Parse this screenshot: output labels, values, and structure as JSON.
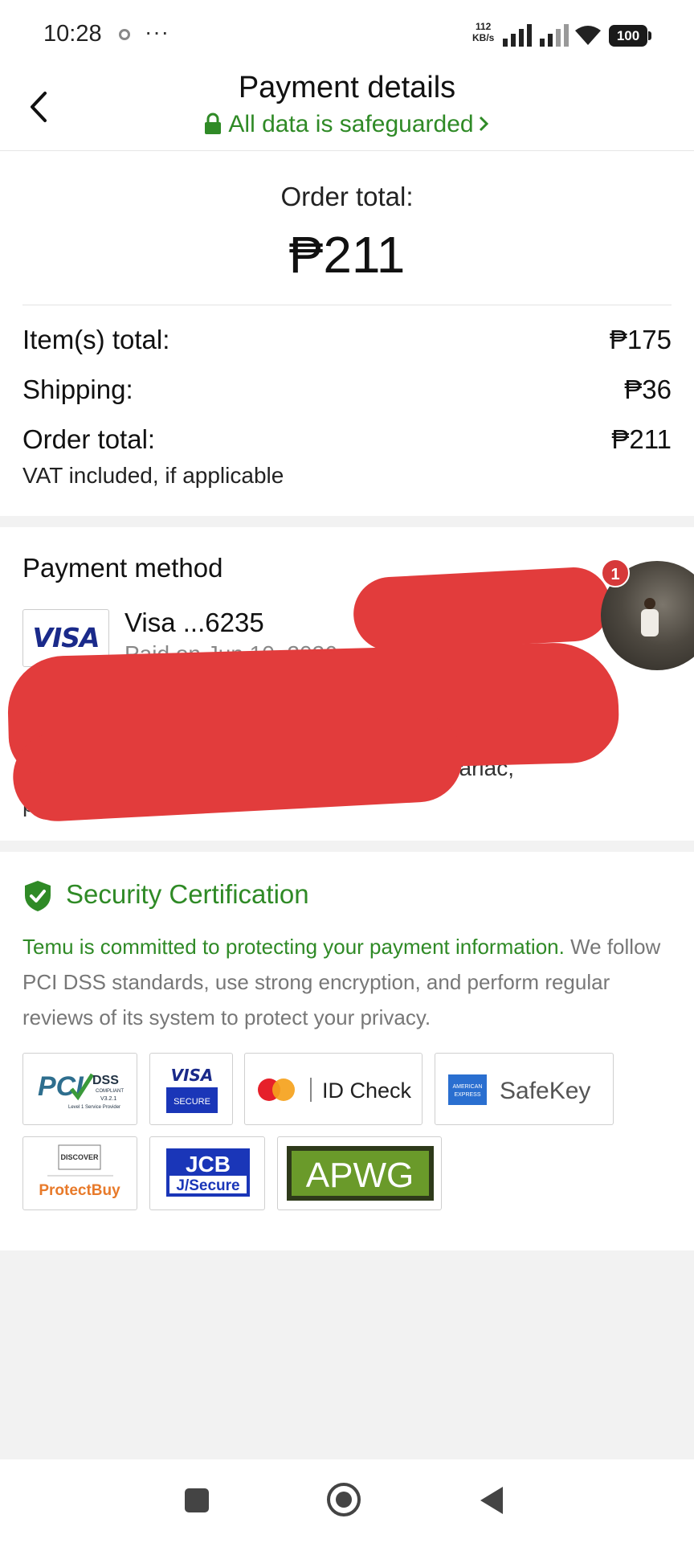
{
  "status_bar": {
    "time": "10:28",
    "more": "···",
    "speed_value": "112",
    "speed_unit": "KB/s",
    "battery": "100"
  },
  "header": {
    "title": "Payment details",
    "safeguard_text": "All data is safeguarded",
    "accent_color": "#2f8a26"
  },
  "order": {
    "total_label": "Order total:",
    "total_amount": "₱211",
    "lines": [
      {
        "label": "Item(s) total:",
        "value": "₱175"
      },
      {
        "label": "Shipping:",
        "value": "₱36"
      },
      {
        "label": "Order total:",
        "value": "₱211"
      }
    ],
    "vat_note": "VAT included, if applicable"
  },
  "payment_method": {
    "title": "Payment method",
    "card_brand": "VISA",
    "card_name": "Visa ...6235",
    "paid_on": "Paid on Jun 10, 2026",
    "address_tail": "Catalaib, Tarlac, Tarlac,",
    "address_tail2": "ppines",
    "notification_count": "1"
  },
  "security": {
    "title": "Security Certification",
    "body_green": "Temu is committed to protecting your payment information.",
    "body_rest": " We follow PCI DSS standards, use strong encryption, and perform regular reviews of its system to protect your privacy.",
    "logos": {
      "pci_main": "PCI",
      "pci_dss": "DSS",
      "pci_compliant": "COMPLIANT",
      "pci_version": "V3.2.1",
      "pci_level": "Level 1 Service Provider",
      "visa_top": "VISA",
      "visa_bottom": "SECURE",
      "mastercard_text": "ID Check",
      "amex_top": "AMERICAN",
      "amex_bottom": "EXPRESS",
      "safekey": "SafeKey",
      "discover": "DISCOVER",
      "protectbuy": "ProtectBuy",
      "jcb_top": "JCB",
      "jcb_bottom": "J/Secure",
      "apwg": "APWG"
    }
  }
}
